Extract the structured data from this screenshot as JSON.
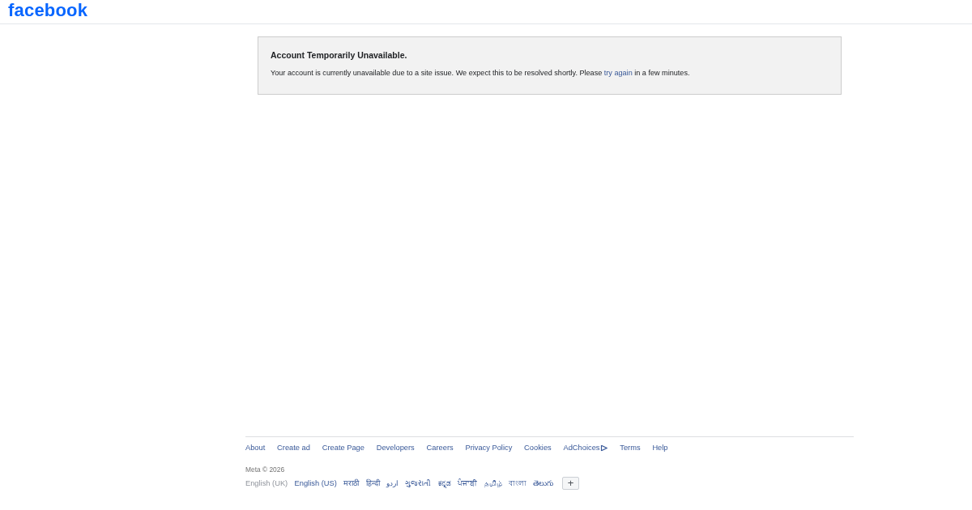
{
  "header": {
    "logo": "facebook"
  },
  "notice": {
    "title": "Account Temporarily Unavailable.",
    "message": [
      {
        "kind": "text",
        "text": "Your account is currently unavailable due to a site issue. We expect this to be resolved shortly. Please "
      },
      {
        "kind": "link",
        "text": "try again"
      },
      {
        "kind": "text",
        "text": " in a few minutes."
      }
    ]
  },
  "footer": {
    "links": [
      {
        "kind": "plain",
        "label": "About"
      },
      {
        "kind": "plain",
        "label": "Create ad"
      },
      {
        "kind": "plain",
        "label": "Create Page"
      },
      {
        "kind": "plain",
        "label": "Developers"
      },
      {
        "kind": "plain",
        "label": "Careers"
      },
      {
        "kind": "plain",
        "label": "Privacy Policy"
      },
      {
        "kind": "plain",
        "label": "Cookies"
      },
      {
        "kind": "ad_choices",
        "label": "AdChoices"
      },
      {
        "kind": "plain",
        "label": "Terms"
      },
      {
        "kind": "plain",
        "label": "Help"
      }
    ],
    "copyright": "Meta © 2026",
    "languages": [
      {
        "label": "English (UK)",
        "selected": true
      },
      {
        "label": "English (US)",
        "selected": false
      },
      {
        "label": "मराठी",
        "selected": false
      },
      {
        "label": "हिन्दी",
        "selected": false
      },
      {
        "label": "اردو",
        "selected": false
      },
      {
        "label": "ગુજરાતી",
        "selected": false
      },
      {
        "label": "ಕನ್ನಡ",
        "selected": false
      },
      {
        "label": "ਪੰਜਾਬੀ",
        "selected": false
      },
      {
        "label": "தமிழ்",
        "selected": false
      },
      {
        "label": "বাংলা",
        "selected": false
      },
      {
        "label": "తెలుగు",
        "selected": false
      }
    ],
    "more_languages_button": "+"
  }
}
